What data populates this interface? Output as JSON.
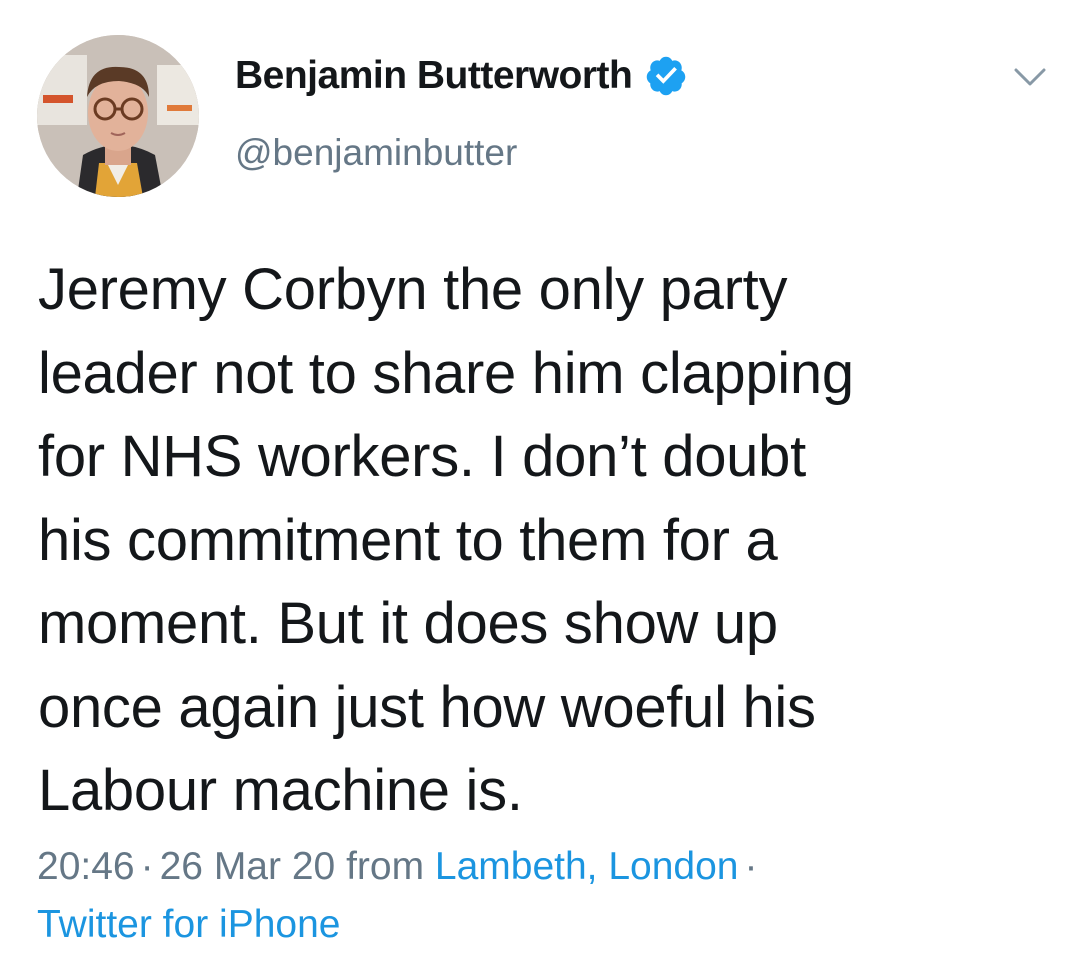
{
  "author": {
    "name": "Benjamin Butterworth",
    "handle": "@benjaminbutter",
    "verified": true
  },
  "tweet": {
    "lines": [
      "Jeremy Corbyn the only party",
      "leader not to share him clapping",
      "for NHS workers. I don’t doubt",
      "his commitment to them for a",
      "moment. But it does show up",
      "once again just how woeful his",
      "Labour machine is."
    ]
  },
  "meta": {
    "time": "20:46",
    "dot": "·",
    "date": "26 Mar 20",
    "from_word": "from",
    "location": "Lambeth, London",
    "source": "Twitter for iPhone"
  },
  "colors": {
    "text": "#14171a",
    "secondary": "#657786",
    "link": "#1b95e0",
    "verified": "#1da1f2"
  },
  "icons": {
    "verified": "verified-badge-icon",
    "menu": "chevron-down-icon",
    "avatar": "profile-photo"
  }
}
